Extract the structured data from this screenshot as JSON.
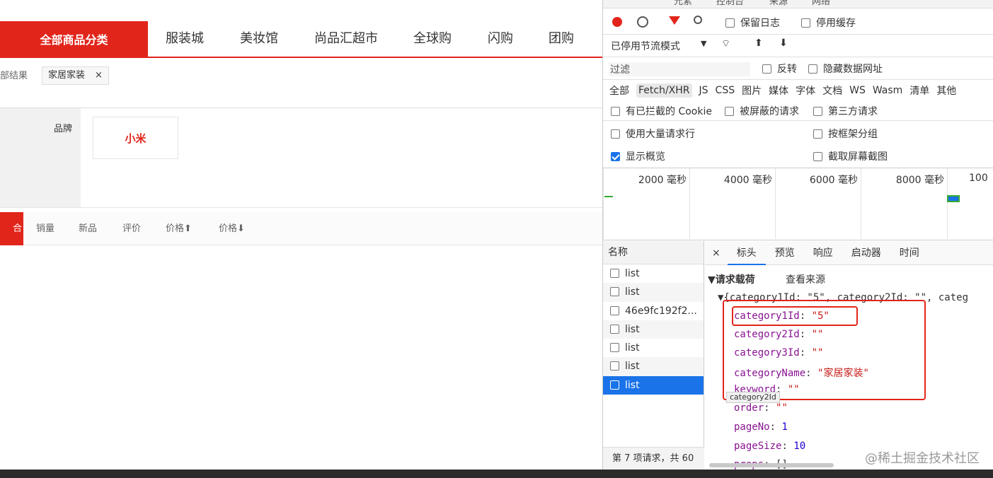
{
  "nav": {
    "all": "全部商品分类",
    "items": [
      "服装城",
      "美妆馆",
      "尚品汇超市",
      "全球购",
      "闪购",
      "团购"
    ]
  },
  "crumb": {
    "label": "部结果",
    "tag": "家居家装",
    "close": "×"
  },
  "selector": {
    "label": "品牌",
    "brand": "小米"
  },
  "sort": {
    "items": [
      "合",
      "销量",
      "新品",
      "评价",
      "价格⬆",
      "价格⬇"
    ]
  },
  "devtools": {
    "toptabs": [
      "元素",
      "控制台",
      "来源",
      "网络"
    ],
    "toolbar1": {
      "preserve": "保留日志",
      "disable_cache": "停用缓存"
    },
    "toolbar2": {
      "throttle": "已停用节流模式"
    },
    "filter": {
      "placeholder": "过滤",
      "invert": "反转",
      "hide_data": "隐藏数据网址"
    },
    "types": [
      "全部",
      "Fetch/XHR",
      "JS",
      "CSS",
      "图片",
      "媒体",
      "字体",
      "文档",
      "WS",
      "Wasm",
      "清单",
      "其他"
    ],
    "opts": {
      "blocked_cookie": "有已拦截的 Cookie",
      "blocked_req": "被屏蔽的请求",
      "third_party": "第三方请求",
      "big_rows": "使用大量请求行",
      "group_frame": "按框架分组",
      "overview": "显示概览",
      "screenshot": "截取屏幕截图"
    },
    "timeline": [
      "2000 毫秒",
      "4000 毫秒",
      "6000 毫秒",
      "8000 毫秒",
      "100"
    ],
    "names": {
      "header": "名称",
      "rows": [
        "list",
        "list",
        "46e9fc192f2...",
        "list",
        "list",
        "list",
        "list"
      ],
      "footer": "第 7 项请求，共 60"
    },
    "tabs": {
      "close": "×",
      "items": [
        "标头",
        "预览",
        "响应",
        "启动器",
        "时间"
      ]
    },
    "payload": {
      "title": "▼请求载荷",
      "source": "查看来源",
      "summary": "▼{category1Id: \"5\", category2Id: \"\", categ",
      "fields": [
        {
          "k": "category1Id",
          "v": "\"5\""
        },
        {
          "k": "category2Id",
          "v": "\"\""
        },
        {
          "k": "category3Id",
          "v": "\"\""
        },
        {
          "k": "categoryName",
          "v": "\"家居家装\""
        },
        {
          "k": "keyword",
          "v": "\"\""
        },
        {
          "k": "order",
          "v": "\"\""
        },
        {
          "k": "pageNo",
          "v": "1"
        },
        {
          "k": "pageSize",
          "v": "10"
        },
        {
          "k": "props",
          "v": "[]"
        }
      ],
      "tooltip": "category2Id"
    }
  },
  "watermark": "@稀土掘金技术社区"
}
